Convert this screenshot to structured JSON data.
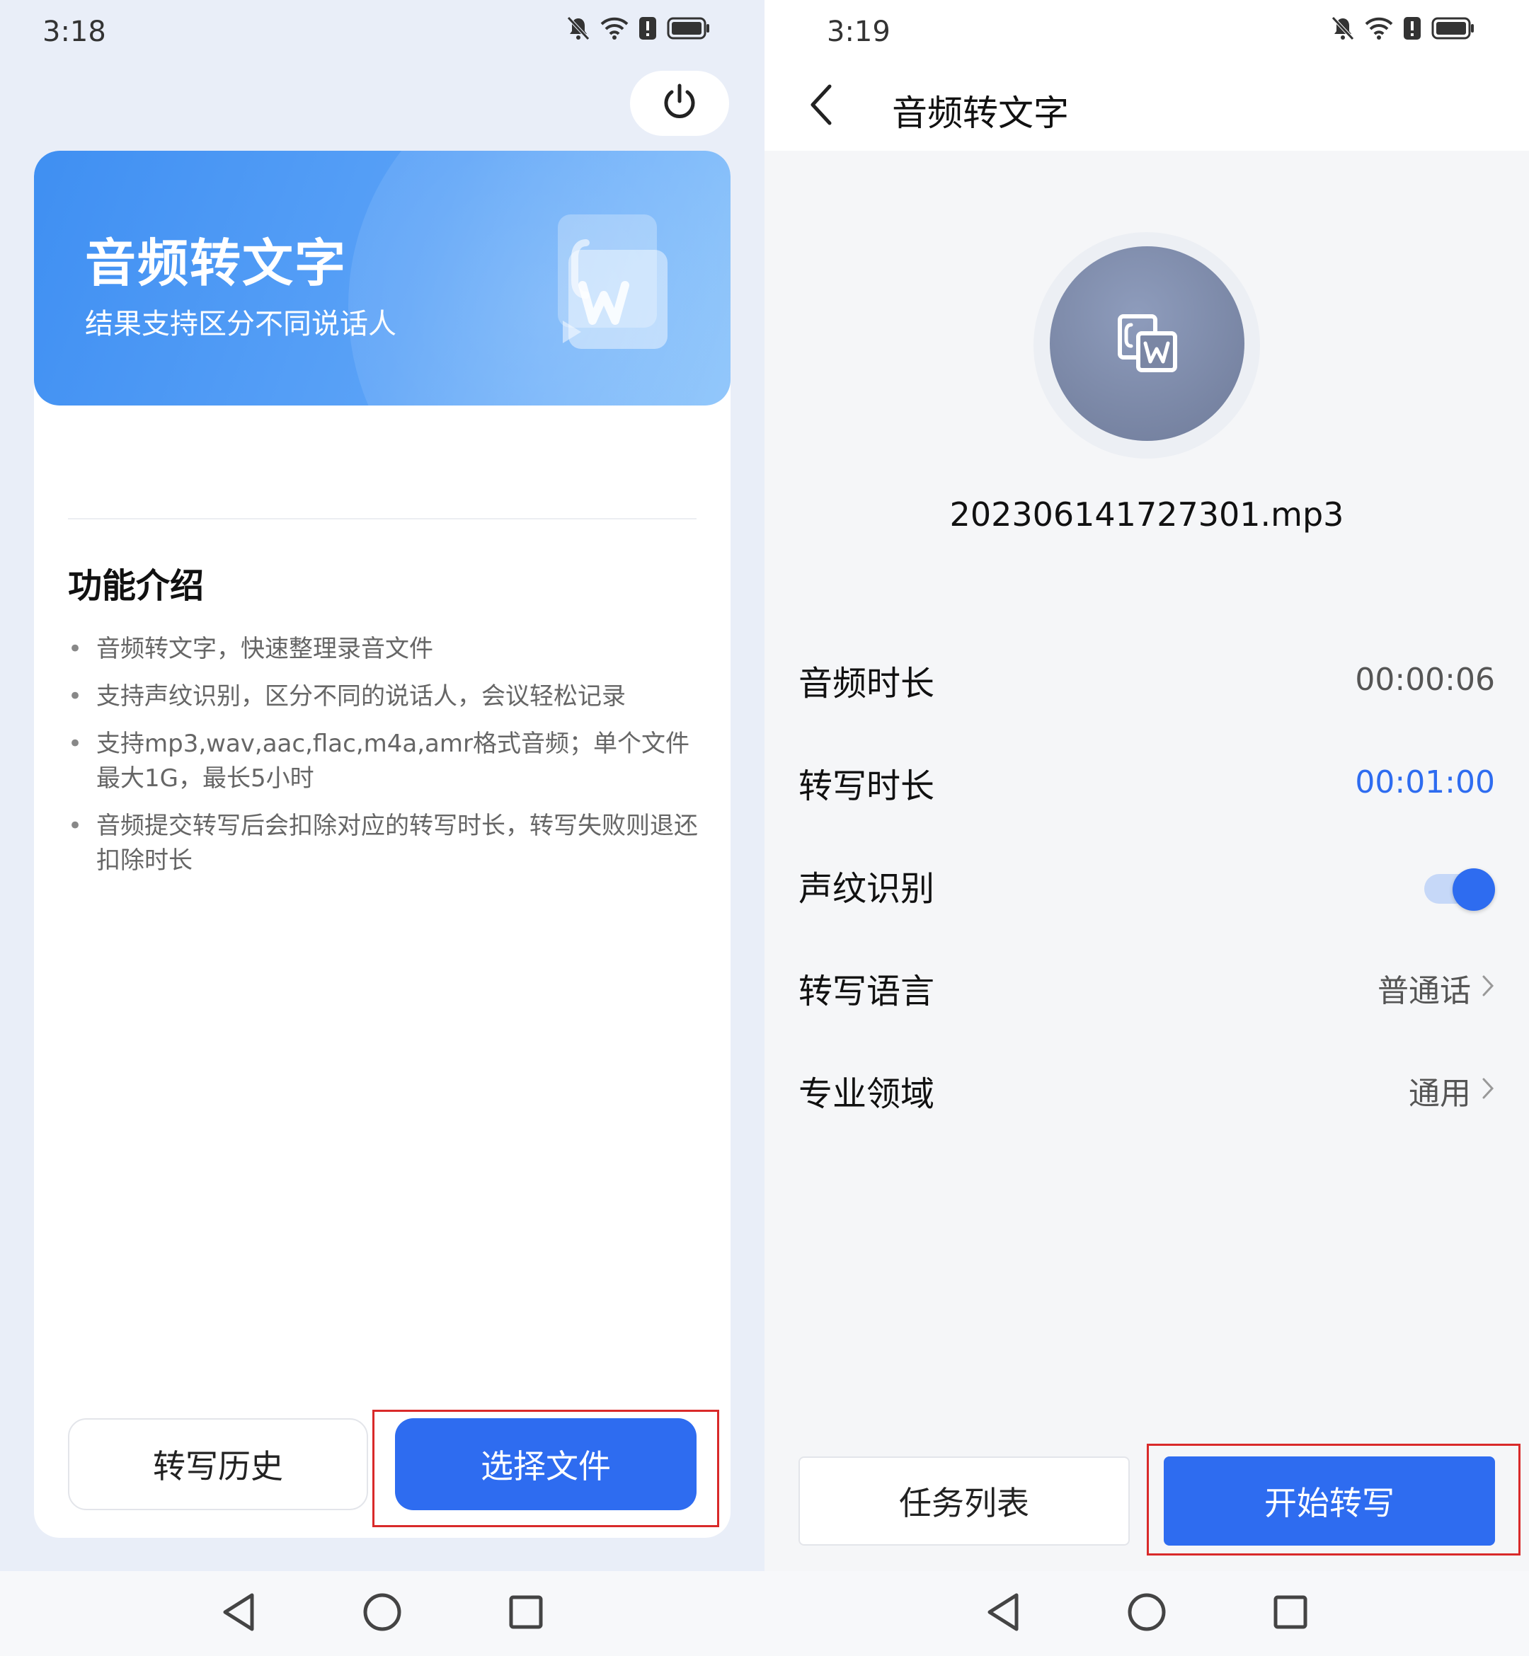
{
  "left": {
    "status": {
      "time": "3:18"
    },
    "banner": {
      "title": "音频转文字",
      "subtitle": "结果支持区分不同说话人"
    },
    "features": {
      "title": "功能介绍",
      "items": [
        "音频转文字，快速整理录音文件",
        "支持声纹识别，区分不同的说话人，会议轻松记录",
        "支持mp3,wav,aac,flac,m4a,amr格式音频；单个文件最大1G，最长5小时",
        "音频提交转写后会扣除对应的转写时长，转写失败则退还扣除时长"
      ]
    },
    "buttons": {
      "history": "转写历史",
      "select_file": "选择文件"
    }
  },
  "right": {
    "status": {
      "time": "3:19"
    },
    "header": {
      "title": "音频转文字"
    },
    "file": {
      "name": "202306141727301.mp3"
    },
    "settings": {
      "audio_duration": {
        "label": "音频时长",
        "value": "00:00:06"
      },
      "transcribe_duration": {
        "label": "转写时长",
        "value": "00:01:00"
      },
      "voiceprint": {
        "label": "声纹识别",
        "enabled": true
      },
      "language": {
        "label": "转写语言",
        "value": "普通话"
      },
      "domain": {
        "label": "专业领域",
        "value": "通用"
      }
    },
    "buttons": {
      "task_list": "任务列表",
      "start": "开始转写"
    }
  },
  "colors": {
    "primary": "#2e6cf0",
    "highlight": "#d92a2a",
    "banner": "#4a97f4"
  },
  "icons": [
    "power-icon",
    "mute-bell-icon",
    "wifi-icon",
    "battery-alert-icon",
    "battery-icon",
    "back-arrow-icon",
    "audio-to-word-icon",
    "chevron-right-icon",
    "nav-back-icon",
    "nav-home-icon",
    "nav-recent-icon"
  ]
}
